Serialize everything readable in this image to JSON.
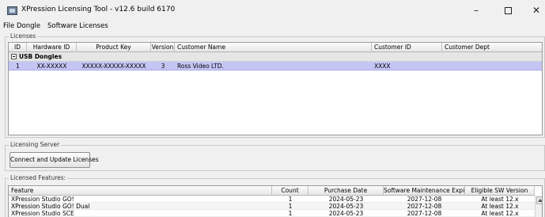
{
  "window": {
    "title": "XPression Licensing Tool - v12.6 build 6170"
  },
  "menu": [
    "File",
    "Dongle",
    "Software Licenses"
  ],
  "licenses": {
    "label": "Licenses",
    "columns": [
      "ID",
      "Hardware ID",
      "Product Key",
      "Version",
      "Customer Name",
      "Customer ID",
      "Customer Dept"
    ],
    "group": "USB Dongles",
    "row": {
      "id": "1",
      "hardware_id": "XX-XXXXX",
      "product_key": "XXXXX-XXXXX-XXXXX",
      "version": "3",
      "customer_name": "Ross Video LTD.",
      "customer_id": "XXXX",
      "customer_dept": ""
    }
  },
  "server": {
    "label": "Licensing Server",
    "button": "Connect and Update Licenses"
  },
  "features": {
    "label": "Licensed Features:",
    "columns": [
      "Feature",
      "Count",
      "Purchase Date",
      "Software Maintenance Expiry",
      "Eligible SW Version"
    ],
    "rows": [
      {
        "feature": "XPression Studio GO!",
        "count": "1",
        "purchase": "2024-05-23",
        "expiry": "2027-12-08",
        "eligible": "At least 12.x"
      },
      {
        "feature": "XPression Studio GO! Dual",
        "count": "1",
        "purchase": "2024-05-23",
        "expiry": "2027-12-08",
        "eligible": "At least 12.x"
      },
      {
        "feature": "XPression Studio SCE",
        "count": "1",
        "purchase": "2024-05-23",
        "expiry": "2027-12-08",
        "eligible": "At least 12.x"
      }
    ]
  }
}
